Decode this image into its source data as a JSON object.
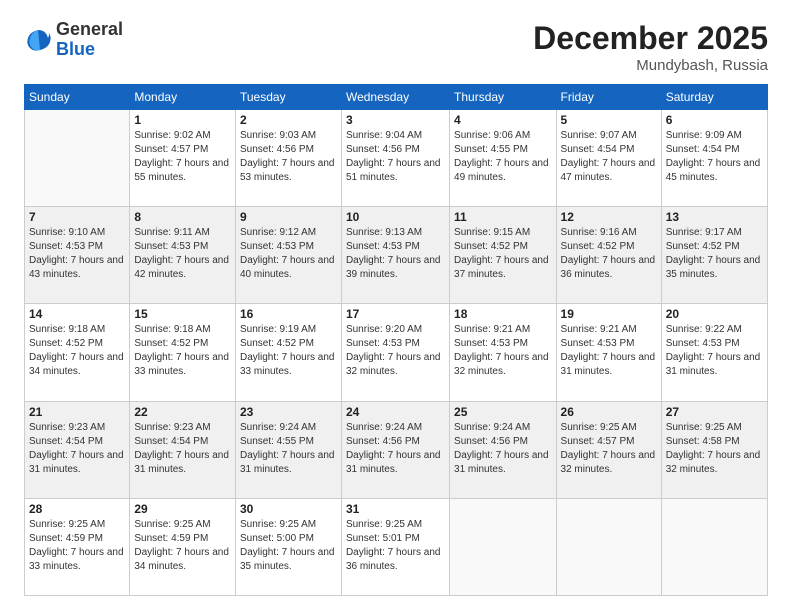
{
  "header": {
    "logo": {
      "general": "General",
      "blue": "Blue"
    },
    "title": "December 2025",
    "location": "Mundybash, Russia"
  },
  "calendar": {
    "days_of_week": [
      "Sunday",
      "Monday",
      "Tuesday",
      "Wednesday",
      "Thursday",
      "Friday",
      "Saturday"
    ],
    "weeks": [
      [
        {
          "day": "",
          "sunrise": "",
          "sunset": "",
          "daylight": ""
        },
        {
          "day": "1",
          "sunrise": "Sunrise: 9:02 AM",
          "sunset": "Sunset: 4:57 PM",
          "daylight": "Daylight: 7 hours and 55 minutes."
        },
        {
          "day": "2",
          "sunrise": "Sunrise: 9:03 AM",
          "sunset": "Sunset: 4:56 PM",
          "daylight": "Daylight: 7 hours and 53 minutes."
        },
        {
          "day": "3",
          "sunrise": "Sunrise: 9:04 AM",
          "sunset": "Sunset: 4:56 PM",
          "daylight": "Daylight: 7 hours and 51 minutes."
        },
        {
          "day": "4",
          "sunrise": "Sunrise: 9:06 AM",
          "sunset": "Sunset: 4:55 PM",
          "daylight": "Daylight: 7 hours and 49 minutes."
        },
        {
          "day": "5",
          "sunrise": "Sunrise: 9:07 AM",
          "sunset": "Sunset: 4:54 PM",
          "daylight": "Daylight: 7 hours and 47 minutes."
        },
        {
          "day": "6",
          "sunrise": "Sunrise: 9:09 AM",
          "sunset": "Sunset: 4:54 PM",
          "daylight": "Daylight: 7 hours and 45 minutes."
        }
      ],
      [
        {
          "day": "7",
          "sunrise": "Sunrise: 9:10 AM",
          "sunset": "Sunset: 4:53 PM",
          "daylight": "Daylight: 7 hours and 43 minutes."
        },
        {
          "day": "8",
          "sunrise": "Sunrise: 9:11 AM",
          "sunset": "Sunset: 4:53 PM",
          "daylight": "Daylight: 7 hours and 42 minutes."
        },
        {
          "day": "9",
          "sunrise": "Sunrise: 9:12 AM",
          "sunset": "Sunset: 4:53 PM",
          "daylight": "Daylight: 7 hours and 40 minutes."
        },
        {
          "day": "10",
          "sunrise": "Sunrise: 9:13 AM",
          "sunset": "Sunset: 4:53 PM",
          "daylight": "Daylight: 7 hours and 39 minutes."
        },
        {
          "day": "11",
          "sunrise": "Sunrise: 9:15 AM",
          "sunset": "Sunset: 4:52 PM",
          "daylight": "Daylight: 7 hours and 37 minutes."
        },
        {
          "day": "12",
          "sunrise": "Sunrise: 9:16 AM",
          "sunset": "Sunset: 4:52 PM",
          "daylight": "Daylight: 7 hours and 36 minutes."
        },
        {
          "day": "13",
          "sunrise": "Sunrise: 9:17 AM",
          "sunset": "Sunset: 4:52 PM",
          "daylight": "Daylight: 7 hours and 35 minutes."
        }
      ],
      [
        {
          "day": "14",
          "sunrise": "Sunrise: 9:18 AM",
          "sunset": "Sunset: 4:52 PM",
          "daylight": "Daylight: 7 hours and 34 minutes."
        },
        {
          "day": "15",
          "sunrise": "Sunrise: 9:18 AM",
          "sunset": "Sunset: 4:52 PM",
          "daylight": "Daylight: 7 hours and 33 minutes."
        },
        {
          "day": "16",
          "sunrise": "Sunrise: 9:19 AM",
          "sunset": "Sunset: 4:52 PM",
          "daylight": "Daylight: 7 hours and 33 minutes."
        },
        {
          "day": "17",
          "sunrise": "Sunrise: 9:20 AM",
          "sunset": "Sunset: 4:53 PM",
          "daylight": "Daylight: 7 hours and 32 minutes."
        },
        {
          "day": "18",
          "sunrise": "Sunrise: 9:21 AM",
          "sunset": "Sunset: 4:53 PM",
          "daylight": "Daylight: 7 hours and 32 minutes."
        },
        {
          "day": "19",
          "sunrise": "Sunrise: 9:21 AM",
          "sunset": "Sunset: 4:53 PM",
          "daylight": "Daylight: 7 hours and 31 minutes."
        },
        {
          "day": "20",
          "sunrise": "Sunrise: 9:22 AM",
          "sunset": "Sunset: 4:53 PM",
          "daylight": "Daylight: 7 hours and 31 minutes."
        }
      ],
      [
        {
          "day": "21",
          "sunrise": "Sunrise: 9:23 AM",
          "sunset": "Sunset: 4:54 PM",
          "daylight": "Daylight: 7 hours and 31 minutes."
        },
        {
          "day": "22",
          "sunrise": "Sunrise: 9:23 AM",
          "sunset": "Sunset: 4:54 PM",
          "daylight": "Daylight: 7 hours and 31 minutes."
        },
        {
          "day": "23",
          "sunrise": "Sunrise: 9:24 AM",
          "sunset": "Sunset: 4:55 PM",
          "daylight": "Daylight: 7 hours and 31 minutes."
        },
        {
          "day": "24",
          "sunrise": "Sunrise: 9:24 AM",
          "sunset": "Sunset: 4:56 PM",
          "daylight": "Daylight: 7 hours and 31 minutes."
        },
        {
          "day": "25",
          "sunrise": "Sunrise: 9:24 AM",
          "sunset": "Sunset: 4:56 PM",
          "daylight": "Daylight: 7 hours and 31 minutes."
        },
        {
          "day": "26",
          "sunrise": "Sunrise: 9:25 AM",
          "sunset": "Sunset: 4:57 PM",
          "daylight": "Daylight: 7 hours and 32 minutes."
        },
        {
          "day": "27",
          "sunrise": "Sunrise: 9:25 AM",
          "sunset": "Sunset: 4:58 PM",
          "daylight": "Daylight: 7 hours and 32 minutes."
        }
      ],
      [
        {
          "day": "28",
          "sunrise": "Sunrise: 9:25 AM",
          "sunset": "Sunset: 4:59 PM",
          "daylight": "Daylight: 7 hours and 33 minutes."
        },
        {
          "day": "29",
          "sunrise": "Sunrise: 9:25 AM",
          "sunset": "Sunset: 4:59 PM",
          "daylight": "Daylight: 7 hours and 34 minutes."
        },
        {
          "day": "30",
          "sunrise": "Sunrise: 9:25 AM",
          "sunset": "Sunset: 5:00 PM",
          "daylight": "Daylight: 7 hours and 35 minutes."
        },
        {
          "day": "31",
          "sunrise": "Sunrise: 9:25 AM",
          "sunset": "Sunset: 5:01 PM",
          "daylight": "Daylight: 7 hours and 36 minutes."
        },
        {
          "day": "",
          "sunrise": "",
          "sunset": "",
          "daylight": ""
        },
        {
          "day": "",
          "sunrise": "",
          "sunset": "",
          "daylight": ""
        },
        {
          "day": "",
          "sunrise": "",
          "sunset": "",
          "daylight": ""
        }
      ]
    ]
  }
}
